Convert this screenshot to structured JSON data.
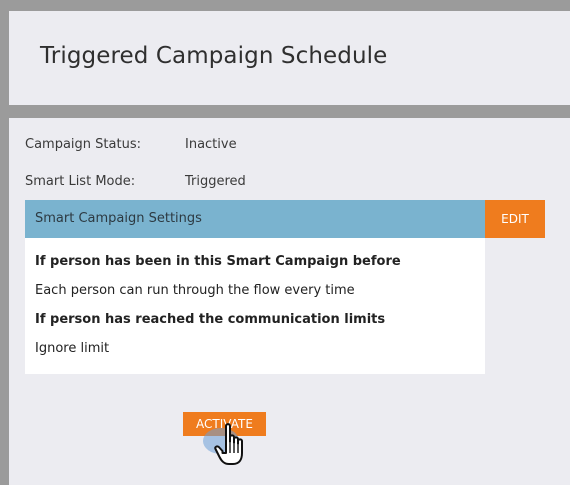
{
  "header": {
    "title": "Triggered Campaign Schedule"
  },
  "properties": [
    {
      "label": "Campaign Status:",
      "value": "Inactive"
    },
    {
      "label": "Smart List Mode:",
      "value": "Triggered"
    }
  ],
  "settings": {
    "title": "Smart Campaign Settings",
    "edit_label": "EDIT",
    "lines": [
      {
        "text": "If person has been in this Smart Campaign before",
        "bold": true
      },
      {
        "text": "Each person can run through the flow every time",
        "bold": false
      },
      {
        "text": "If person has reached the communication limits",
        "bold": true
      },
      {
        "text": "Ignore limit",
        "bold": false
      }
    ]
  },
  "actions": {
    "activate_label": "ACTIVATE"
  },
  "colors": {
    "background": "#9b9b9b",
    "panel": "#ececf1",
    "settings_header": "#7ab3cf",
    "accent_orange": "#ef7c1e"
  },
  "cursor": {
    "icon": "hand-pointer-icon"
  }
}
